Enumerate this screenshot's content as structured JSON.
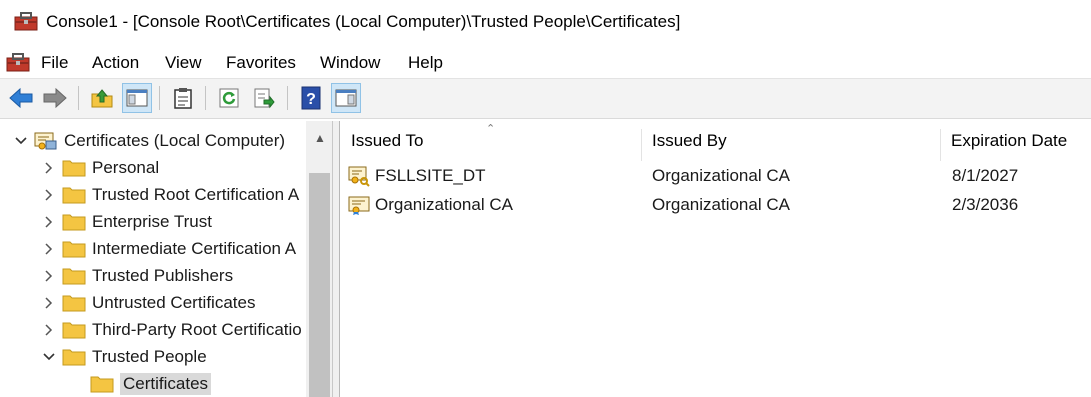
{
  "window": {
    "title": "Console1 - [Console Root\\Certificates (Local Computer)\\Trusted People\\Certificates]"
  },
  "menu": {
    "items": [
      "File",
      "Action",
      "View",
      "Favorites",
      "Window",
      "Help"
    ]
  },
  "toolbar": {
    "buttons": [
      "back-icon",
      "forward-icon",
      "up-folder-icon",
      "show-hide-tree-icon",
      "properties-icon",
      "refresh-icon",
      "export-list-icon",
      "help-icon",
      "show-hide-action-pane-icon"
    ]
  },
  "tree": {
    "root": "Certificates (Local Computer)",
    "items": [
      "Personal",
      "Trusted Root Certification A",
      "Enterprise Trust",
      "Intermediate Certification A",
      "Trusted Publishers",
      "Untrusted Certificates",
      "Third-Party Root Certificatio",
      "Trusted People",
      "Certificates"
    ]
  },
  "list": {
    "columns": [
      "Issued To",
      "Issued By",
      "Expiration Date"
    ],
    "rows": [
      {
        "issued_to": "FSLLSITE_DT",
        "issued_by": "Organizational CA",
        "expiration": "8/1/2027"
      },
      {
        "issued_to": "Organizational CA",
        "issued_by": "Organizational CA",
        "expiration": "2/3/2036"
      }
    ]
  },
  "colors": {
    "folder": "#f4c542",
    "selection": "#d9d9d9",
    "pressed": "#cfe6f7",
    "arrow_blue": "#2f7fd6"
  }
}
